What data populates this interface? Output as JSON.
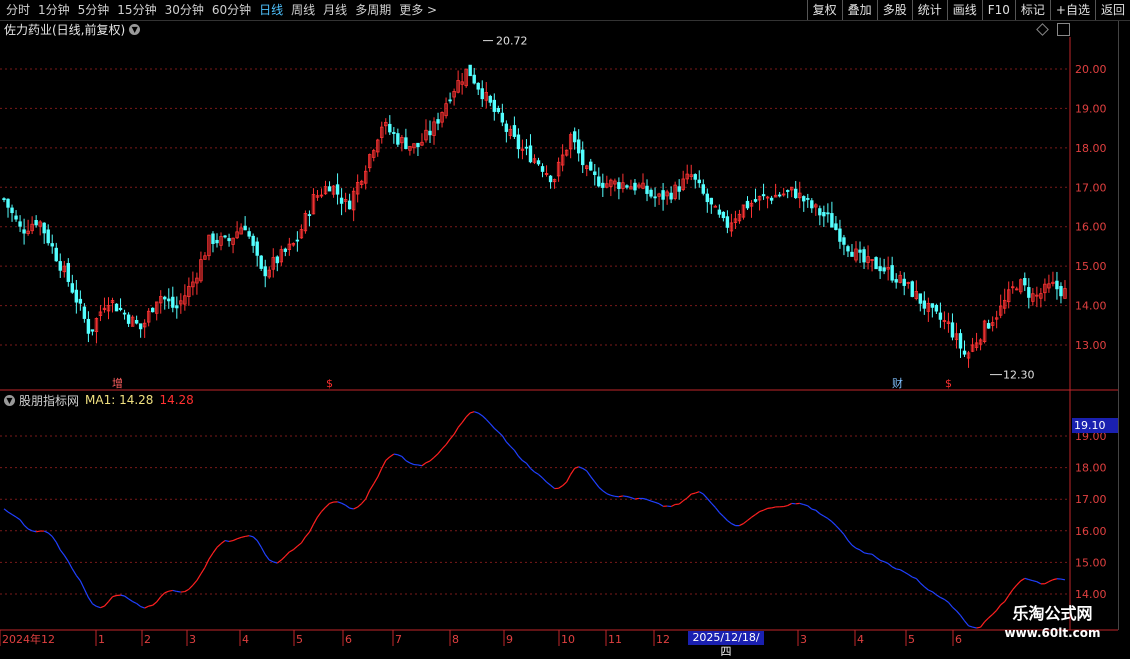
{
  "toolbar": {
    "periods": [
      "分时",
      "1分钟",
      "5分钟",
      "15分钟",
      "30分钟",
      "60分钟",
      "日线",
      "周线",
      "月线",
      "多周期",
      "更多 >"
    ],
    "active_period": "日线",
    "right_buttons": [
      "复权",
      "叠加",
      "多股",
      "统计",
      "画线",
      "F10",
      "标记",
      "+自选",
      "返回"
    ]
  },
  "main_title": "佐力药业(日线,前复权)",
  "y_axis_main": [
    "20.00",
    "19.00",
    "18.00",
    "17.00",
    "16.00",
    "15.00",
    "14.00",
    "13.00"
  ],
  "y_axis_sub": [
    "19.00",
    "18.00",
    "17.00",
    "16.00",
    "15.00",
    "14.00"
  ],
  "high_label": "20.72",
  "low_label": "12.30",
  "markers": [
    {
      "text": "增",
      "color": "#ff6060"
    },
    {
      "text": "$",
      "color": "#ff3030"
    },
    {
      "text": "财",
      "color": "#80c0ff"
    },
    {
      "text": "$",
      "color": "#ff3030"
    }
  ],
  "indicator": {
    "name": "股朋指标网",
    "ma_label": "MA1: 14.28",
    "ma_value": "14.28",
    "current_price": "19.10"
  },
  "x_axis": [
    "2024年12",
    "1",
    "2",
    "3",
    "4",
    "5",
    "6",
    "7",
    "8",
    "9",
    "10",
    "11",
    "12",
    "2",
    "3",
    "4",
    "5",
    "6"
  ],
  "date_highlight": "2025/12/18/四",
  "watermark": {
    "line1": "乐淘公式网",
    "line2": "www.60lt.com"
  },
  "colors": {
    "up": "#ff3333",
    "down": "#54ffff",
    "ma_up": "#ff2020",
    "ma_down": "#2040ff",
    "grid": "#7a1a1a",
    "axis": "#c0262a"
  },
  "chart_data": {
    "type": "candlestick",
    "title": "佐力药业(日线,前复权)",
    "ylim": [
      12.3,
      20.72
    ],
    "price_path_knots": [
      [
        0,
        16.7
      ],
      [
        10,
        15.9
      ],
      [
        20,
        16.2
      ],
      [
        30,
        15.3
      ],
      [
        40,
        14.4
      ],
      [
        50,
        13.3
      ],
      [
        60,
        14.2
      ],
      [
        70,
        13.8
      ],
      [
        80,
        13.4
      ],
      [
        90,
        14.3
      ],
      [
        100,
        13.9
      ],
      [
        110,
        14.6
      ],
      [
        120,
        15.7
      ],
      [
        130,
        15.6
      ],
      [
        140,
        16.1
      ],
      [
        150,
        14.8
      ],
      [
        160,
        15.2
      ],
      [
        170,
        15.6
      ],
      [
        180,
        16.7
      ],
      [
        190,
        17.1
      ],
      [
        200,
        16.5
      ],
      [
        210,
        17.5
      ],
      [
        220,
        18.6
      ],
      [
        230,
        18.2
      ],
      [
        240,
        18.0
      ],
      [
        250,
        18.5
      ],
      [
        260,
        19.4
      ],
      [
        270,
        20.0
      ],
      [
        280,
        19.3
      ],
      [
        290,
        18.6
      ],
      [
        300,
        18.0
      ],
      [
        310,
        17.7
      ],
      [
        320,
        17.2
      ],
      [
        330,
        18.3
      ],
      [
        340,
        17.3
      ],
      [
        350,
        17.1
      ],
      [
        360,
        17.1
      ],
      [
        370,
        17.0
      ],
      [
        380,
        16.7
      ],
      [
        390,
        16.9
      ],
      [
        400,
        17.3
      ],
      [
        410,
        16.6
      ],
      [
        420,
        16.0
      ],
      [
        430,
        16.5
      ],
      [
        440,
        16.7
      ],
      [
        450,
        16.8
      ],
      [
        460,
        16.9
      ],
      [
        470,
        16.5
      ],
      [
        480,
        16.2
      ],
      [
        490,
        15.6
      ],
      [
        500,
        15.1
      ],
      [
        510,
        15.0
      ],
      [
        520,
        14.7
      ],
      [
        530,
        14.3
      ],
      [
        540,
        13.8
      ],
      [
        550,
        13.5
      ],
      [
        560,
        12.7
      ],
      [
        570,
        13.4
      ],
      [
        580,
        13.9
      ],
      [
        590,
        14.6
      ],
      [
        600,
        14.2
      ],
      [
        610,
        14.5
      ],
      [
        620,
        14.3
      ]
    ],
    "indicator_series": {
      "name": "MA1",
      "last": 14.28,
      "ylim": [
        14.0,
        19.1
      ]
    }
  }
}
